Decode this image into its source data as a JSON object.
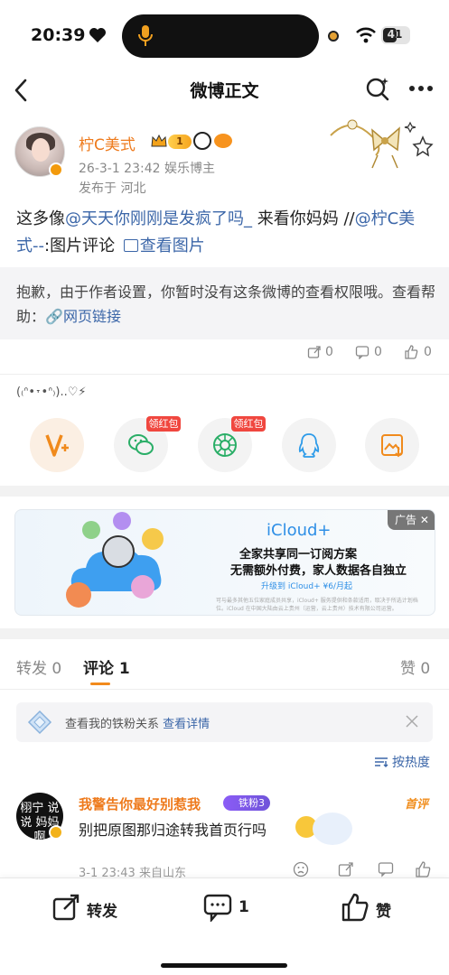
{
  "status_bar": {
    "time": "20:39",
    "battery": "41"
  },
  "nav": {
    "title": "微博正文"
  },
  "post": {
    "author": "柠C美式",
    "level": "1",
    "meta": "26-3-1 23:42  娱乐博主",
    "location": "发布于 河北",
    "text_prefix": "这多像",
    "mention1": "@天天你刚刚是发疯了吗_",
    "text_middle": " 来看你妈妈 //",
    "mention2": "@柠C美式--",
    "text_suffix": ":图片评论 ",
    "view_image": "查看图片",
    "notice": "抱歉，由于作者设置，你暂时没有这条微博的查看权限哦。查看帮助：",
    "notice_link": "网页链接",
    "repost_count": "0",
    "comment_count": "0",
    "like_count": "0"
  },
  "share": {
    "kaomoji": "(₍ᐢ•˕•ᐢ₎)..♡⚡",
    "red_tag_1": "领红包",
    "red_tag_2": "领红包"
  },
  "ad": {
    "brand": "iCloud+",
    "line1": "全家共享同一订阅方案",
    "line2": "无需额外付费，家人数据各自独立",
    "cta": "升级到 iCloud+ ¥6/月起",
    "fine_print": "可与最多其他五位家庭成员共享，iCloud+ 服务提供和条款适用，取决于所选计划档位。iCloud 在中国大陆由云上贵州（运营，云上贵州）技术有限公司运营。",
    "tag": "广告 ✕"
  },
  "tabs": {
    "repost": "转发 0",
    "comment": "评论 1",
    "like": "赞 0"
  },
  "fan_bar": {
    "text": "查看我的铁粉关系 ",
    "link": "查看详情"
  },
  "sort": {
    "label": "按热度"
  },
  "comment": {
    "avatar_text": "栩宁 说说 妈妈啊",
    "name": "我警告你最好别惹我",
    "fan_badge": "铁粉3",
    "first": "首评",
    "text": "别把原图那归途转我首页行吗",
    "meta": "3-1 23:43  来自山东"
  },
  "bottom_bar": {
    "repost": "转发",
    "comment_count": "1",
    "like": "赞"
  },
  "colors": {
    "accent_orange": "#ee7a1c",
    "link_blue": "#3b66a8",
    "red_tag": "#f0473f"
  }
}
